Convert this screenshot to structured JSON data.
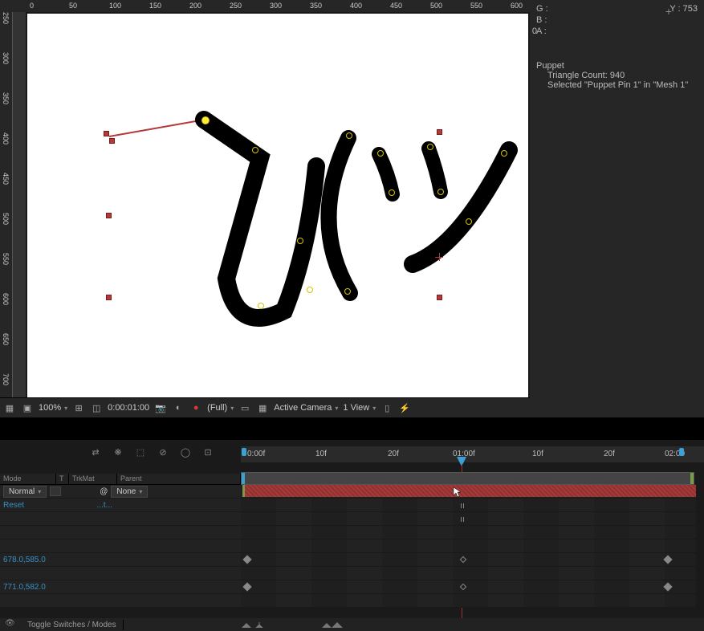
{
  "ruler_h": [
    "0",
    "50",
    "100",
    "150",
    "200",
    "250",
    "300",
    "350",
    "400",
    "450",
    "500",
    "550",
    "600"
  ],
  "ruler_v": [
    "250",
    "300",
    "350",
    "400",
    "450",
    "500",
    "550",
    "600",
    "650",
    "700"
  ],
  "viewport_footer": {
    "zoom": "100%",
    "timecode": "0:00:01:00",
    "res": "(Full)",
    "camera": "Active Camera",
    "view": "1 View"
  },
  "info": {
    "g_label": "G :",
    "b_label": "B :",
    "a_label": "A :",
    "a_value": "0",
    "y_label": "Y :",
    "y_value": "753",
    "section": "Puppet",
    "tri_label": "Triangle Count:",
    "tri_value": "940",
    "sel": "Selected \"Puppet Pin 1\" in \"Mesh 1\""
  },
  "timeline": {
    "marks": [
      "0:00f",
      "10f",
      "20f",
      "01:00f",
      "10f",
      "20f",
      "02:00"
    ],
    "cols": {
      "mode": "Mode",
      "t": "T",
      "trkmat": "TrkMat",
      "parent": "Parent"
    },
    "mode_val": "Normal",
    "parent_val": "None",
    "reset": "Reset",
    "expr": "...t...",
    "pos1": "678.0,585.0",
    "pos2": "771.0,582.0",
    "footer_btn": "Toggle Switches / Modes"
  }
}
